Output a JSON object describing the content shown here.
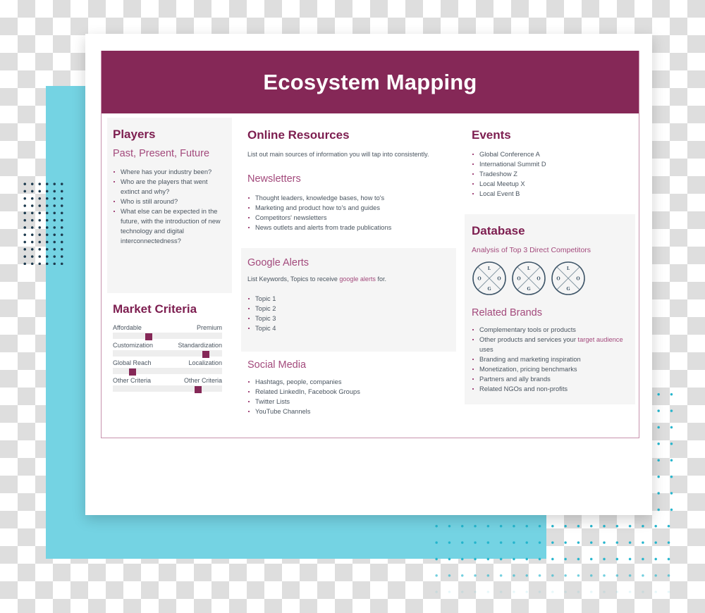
{
  "title": "Ecosystem Mapping",
  "colors": {
    "brand": "#852857",
    "accent_text": "#a34a7c",
    "decor_cyan": "#74d3e3",
    "body_text": "#4a5560"
  },
  "players": {
    "heading": "Players",
    "subheading": "Past, Present, Future",
    "items": [
      "Where has your industry been?",
      "Who are the players that went extinct and why?",
      "Who is still around?",
      "What else can be expected in the future, with the introduction of new technology and digital interconnectedness?"
    ]
  },
  "market_criteria": {
    "heading": "Market Criteria",
    "rows": [
      {
        "left": "Affordable",
        "right": "Premium",
        "value": 0.33
      },
      {
        "left": "Customization",
        "right": "Standardization",
        "value": 0.85
      },
      {
        "left": "Global Reach",
        "right": "Localization",
        "value": 0.18
      },
      {
        "left": "Other Criteria",
        "right": "Other Criteria",
        "value": 0.78
      }
    ]
  },
  "online_resources": {
    "heading": "Online Resources",
    "description": "List out main sources of information you will tap into consistently.",
    "newsletters": {
      "heading": "Newsletters",
      "items": [
        "Thought leaders, knowledge bases, how to's",
        "Marketing and product how to's and guides",
        "Competitors' newsletters",
        "News outlets and alerts from trade publications"
      ]
    },
    "google_alerts": {
      "heading": "Google Alerts",
      "description_prefix": "List Keywords, Topics to receive ",
      "description_link": "google alerts",
      "description_suffix": " for.",
      "items": [
        "Topic 1",
        "Topic 2",
        "Topic 3",
        "Topic 4"
      ]
    },
    "social_media": {
      "heading": "Social Media",
      "items": [
        "Hashtags, people, companies",
        "Related LinkedIn, Facebook Groups",
        "Twitter Lists",
        "YouTube Channels"
      ]
    }
  },
  "events": {
    "heading": "Events",
    "items": [
      "Global Conference A",
      "International Summit D",
      "Tradeshow Z",
      "Local Meetup X",
      "Local Event B"
    ]
  },
  "database": {
    "heading": "Database",
    "subheading": "Analysis of Top 3 Direct Competitors",
    "logos": [
      {
        "top": "L",
        "left": "O",
        "right": "O",
        "bottom": "G"
      },
      {
        "top": "L",
        "left": "O",
        "right": "O",
        "bottom": "G"
      },
      {
        "top": "L",
        "left": "O",
        "right": "O",
        "bottom": "G"
      }
    ],
    "related_brands": {
      "heading": "Related Brands",
      "items": [
        {
          "text": "Complementary tools or products"
        },
        {
          "prefix": "Other products and services your ",
          "link": "target audience",
          "suffix": " uses"
        },
        {
          "text": "Branding and marketing inspiration"
        },
        {
          "text": "Monetization, pricing benchmarks"
        },
        {
          "text": "Partners and ally brands"
        },
        {
          "text": "Related NGOs and non-profits"
        }
      ]
    }
  }
}
